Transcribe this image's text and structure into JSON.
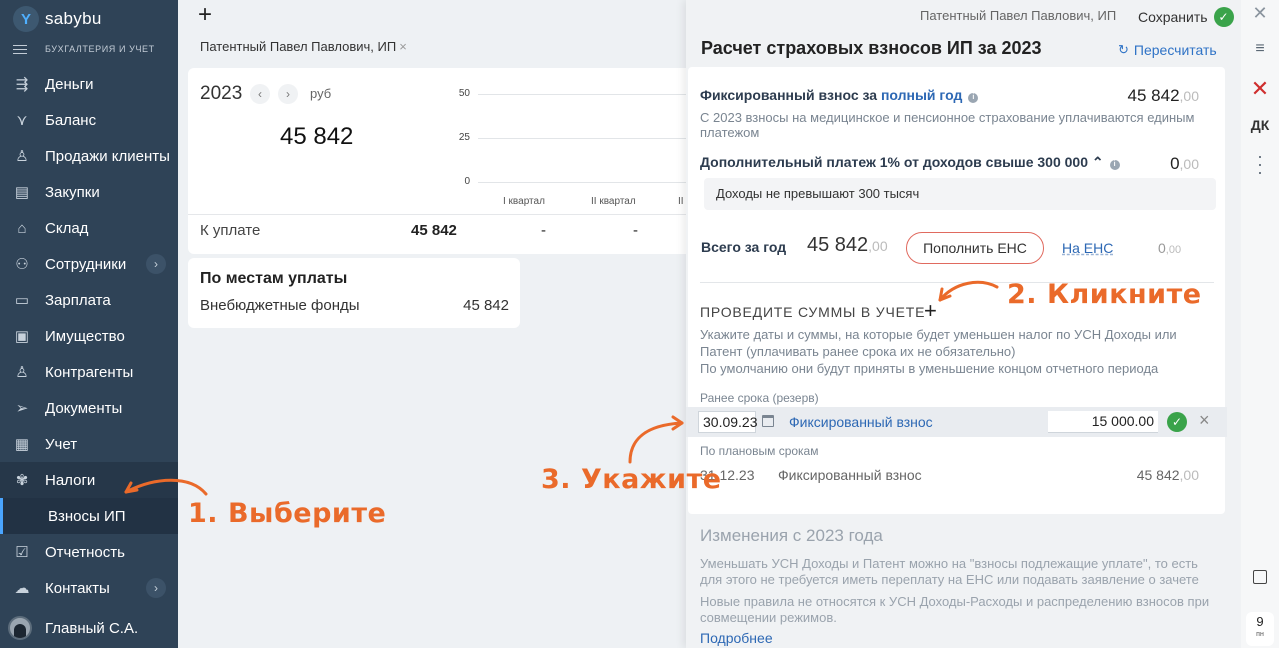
{
  "app": {
    "logo": "sabybu",
    "section": "БУХГАЛТЕРИЯ И УЧЕТ"
  },
  "colors": {
    "sidebar": "#2f4357",
    "accent": "#2d68b4",
    "annotation": "#ea6a2a",
    "success": "#3aa34a",
    "danger": "#cf2e2e"
  },
  "sidebar": {
    "items": [
      {
        "label": "Деньги",
        "icon": "money-icon"
      },
      {
        "label": "Баланс",
        "icon": "balance-icon"
      },
      {
        "label": "Продажи клиенты",
        "icon": "sales-icon"
      },
      {
        "label": "Закупки",
        "icon": "purchases-icon"
      },
      {
        "label": "Склад",
        "icon": "warehouse-icon"
      },
      {
        "label": "Сотрудники",
        "icon": "employees-icon"
      },
      {
        "label": "Зарплата",
        "icon": "salary-icon"
      },
      {
        "label": "Имущество",
        "icon": "property-icon"
      },
      {
        "label": "Контрагенты",
        "icon": "contractors-icon"
      },
      {
        "label": "Документы",
        "icon": "documents-icon"
      },
      {
        "label": "Учет",
        "icon": "accounting-icon"
      },
      {
        "label": "Налоги",
        "icon": "taxes-icon"
      },
      {
        "label": "Взносы ИП",
        "icon": ""
      },
      {
        "label": "Отчетность",
        "icon": "reports-icon"
      },
      {
        "label": "Контакты",
        "icon": "contacts-icon"
      }
    ],
    "user": "Главный С.А."
  },
  "main": {
    "breadcrumb": "Патентный Павел Павлович, ИП",
    "year": "2023",
    "currency": "руб",
    "total": "45 842",
    "y_ticks": [
      "50",
      "25",
      "0"
    ],
    "quarters": [
      "I квартал",
      "II квартал",
      "II"
    ],
    "pay_label": "К уплате",
    "pay_values": [
      "45 842",
      "-",
      "-"
    ],
    "places_title": "По местам уплаты",
    "places_row_label": "Внебюджетные фонды",
    "places_row_value": "45 842"
  },
  "panel": {
    "owner": "Патентный Павел Павлович, ИП",
    "save": "Сохранить",
    "title": "Расчет страховых взносов ИП за 2023",
    "recalc": "Пересчитать",
    "fixed_title_a": "Фиксированный взнос за",
    "fixed_title_b": "полный год",
    "fixed_int": "45 842",
    "fixed_dec": ",00",
    "fixed_desc": "С 2023 взносы на медицинское и пенсионное страхование уплачиваются единым платежом",
    "extra_title": "Дополнительный платеж 1% от доходов свыше 300 000",
    "extra_int": "0",
    "extra_dec": ",00",
    "income_note": "Доходы не превышают 300 тысяч",
    "total_label": "Всего за год",
    "total_int": "45 842",
    "total_dec": ",00",
    "ens_button": "Пополнить ЕНС",
    "ens_link": "На ЕНС",
    "ens_int": "0",
    "ens_dec": ",00",
    "post_title": "ПРОВЕДИТЕ СУММЫ В УЧЕТЕ",
    "post_desc1": "Укажите даты и суммы, на которые будет уменьшен налог по УСН Доходы или Патент (уплачивать ранее срока их не обязательно)",
    "post_desc2": "По умолчанию они будут приняты в уменьшение концом отчетного периода",
    "early_label": "Ранее срока (резерв)",
    "early_date": "30.09.23",
    "early_name": "Фиксированный взнос",
    "early_amount": "15 000.00",
    "plan_label": "По плановым срокам",
    "plan_date": "31.12.23",
    "plan_name": "Фиксированный взнос",
    "plan_int": "45 842",
    "plan_dec": ",00",
    "changes_title": "Изменения с 2023 года",
    "changes_p1": "Уменьшать УСН Доходы и Патент можно на \"взносы подлежащие уплате\", то есть для этого не требуется иметь переплату на ЕНС или подавать заявление о зачете",
    "changes_p2": "Новые правила не относятся к УСН Доходы-Расходы и распределению взносов при совмещении режимов.",
    "more": "Подробнее"
  },
  "rail": {
    "dk": "ДК",
    "day": "9",
    "weekday": "пн"
  },
  "annotations": {
    "a1": "1. Выберите",
    "a2": "2. Кликните",
    "a3": "3. Укажите"
  }
}
